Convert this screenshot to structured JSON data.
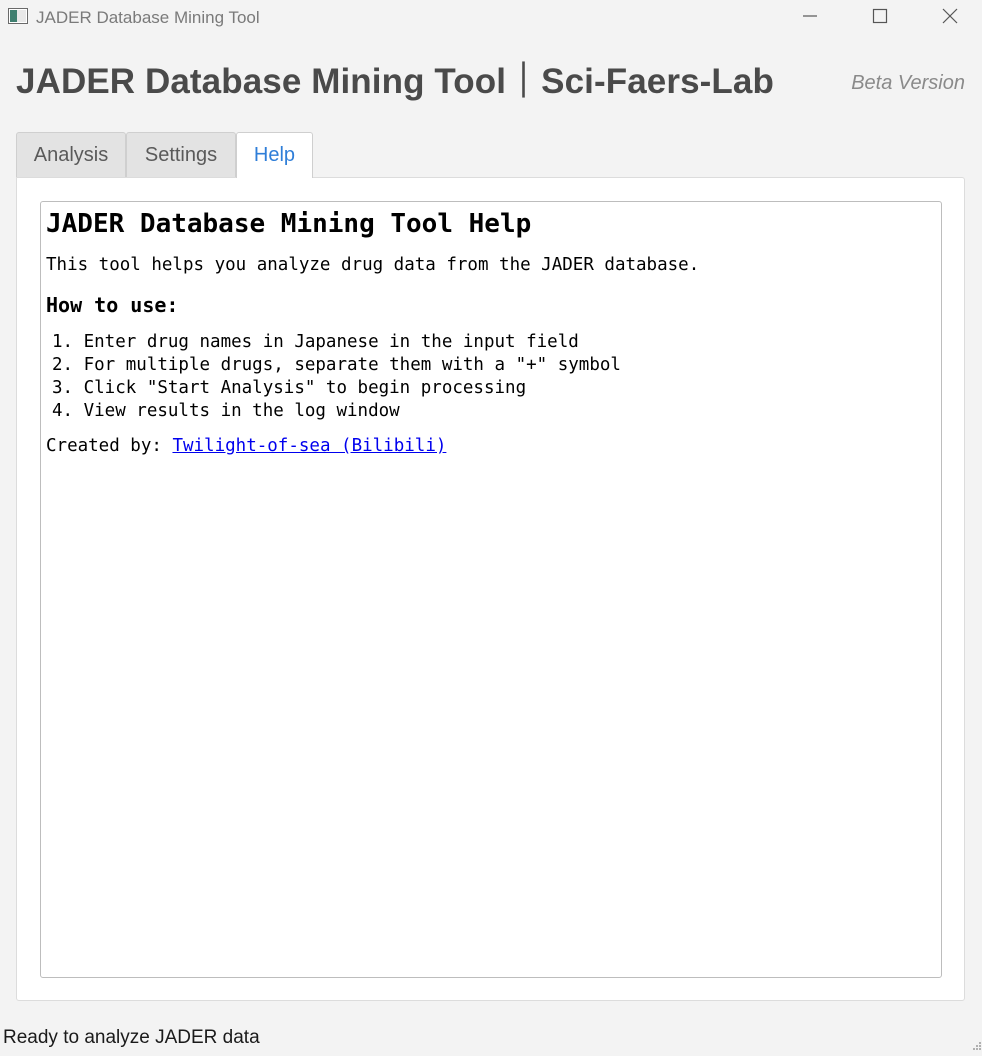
{
  "window": {
    "title": "JADER Database Mining Tool",
    "icon": "app-window-icon",
    "controls": [
      "minimize-icon",
      "maximize-icon",
      "close-icon"
    ]
  },
  "header": {
    "title": "JADER Database Mining Tool｜Sci-Faers-Lab",
    "badge": "Beta Version"
  },
  "tabs": [
    {
      "label": "Analysis",
      "active": false
    },
    {
      "label": "Settings",
      "active": false
    },
    {
      "label": "Help",
      "active": true
    }
  ],
  "help": {
    "title": "JADER Database Mining Tool Help",
    "intro": "This tool helps you analyze drug data from the JADER database.",
    "subtitle": "How to use:",
    "steps": [
      "1. Enter drug names in Japanese in the input field",
      "2. For multiple drugs, separate them with a \"+\" symbol",
      "3. Click \"Start Analysis\" to begin processing",
      "4. View results in the log window"
    ],
    "created_by_label": "Created by:",
    "author_link": "Twilight-of-sea (Bilibili)"
  },
  "status_bar": {
    "text": "Ready to analyze JADER data"
  },
  "colors": {
    "background": "#f3f3f3",
    "active_tab_text": "#2f7ed8",
    "link": "#0000ee",
    "header_text": "#4a4a4a"
  }
}
